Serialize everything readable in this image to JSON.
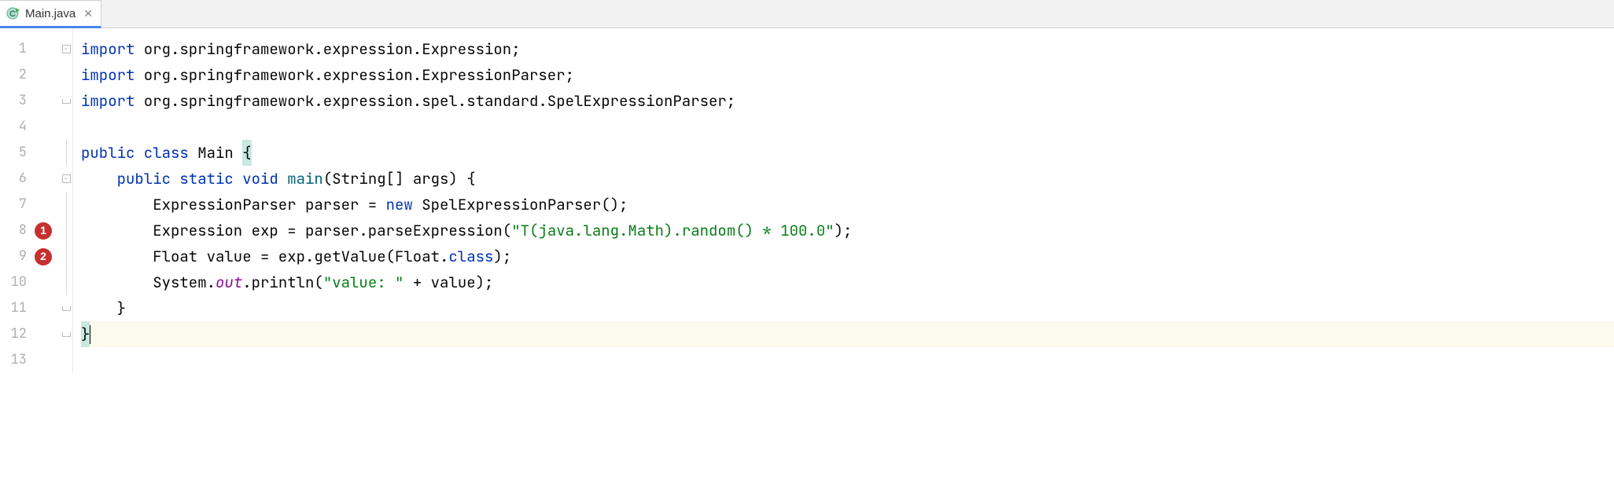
{
  "tab": {
    "label": "Main.java",
    "icon": "java-class-icon"
  },
  "markers": {
    "line8": "1",
    "line9": "2"
  },
  "code": {
    "lines": [
      {
        "num": "1"
      },
      {
        "num": "2"
      },
      {
        "num": "3"
      },
      {
        "num": "4"
      },
      {
        "num": "5"
      },
      {
        "num": "6"
      },
      {
        "num": "7"
      },
      {
        "num": "8"
      },
      {
        "num": "9"
      },
      {
        "num": "10"
      },
      {
        "num": "11"
      },
      {
        "num": "12"
      },
      {
        "num": "13"
      }
    ],
    "l1": {
      "kw": "import",
      "rest": " org.springframework.expression.Expression;"
    },
    "l2": {
      "kw": "import",
      "rest": " org.springframework.expression.ExpressionParser;"
    },
    "l3": {
      "kw": "import",
      "rest": " org.springframework.expression.spel.standard.SpelExpressionParser;"
    },
    "l5": {
      "kw1": "public class ",
      "name": "Main ",
      "brace": "{"
    },
    "l6": {
      "indent": "    ",
      "kw": "public static void ",
      "fn": "main",
      "args": "(String[] args) {"
    },
    "l7": {
      "indent": "        ",
      "p1": "ExpressionParser parser = ",
      "kw": "new ",
      "p2": "SpelExpressionParser();"
    },
    "l8": {
      "indent": "        ",
      "p1": "Expression exp = parser.parseExpression(",
      "str": "\"T(java.lang.Math).random() * 100.0\"",
      "p2": ");"
    },
    "l9": {
      "indent": "        ",
      "p1": "Float value = exp.getValue(Float.",
      "kw": "class",
      "p2": ");"
    },
    "l10": {
      "indent": "        ",
      "p1": "System.",
      "out": "out",
      "p2": ".println(",
      "str": "\"value: \"",
      "p3": " + value);"
    },
    "l11": {
      "indent": "    ",
      "brace": "}"
    },
    "l12": {
      "brace": "}"
    }
  }
}
